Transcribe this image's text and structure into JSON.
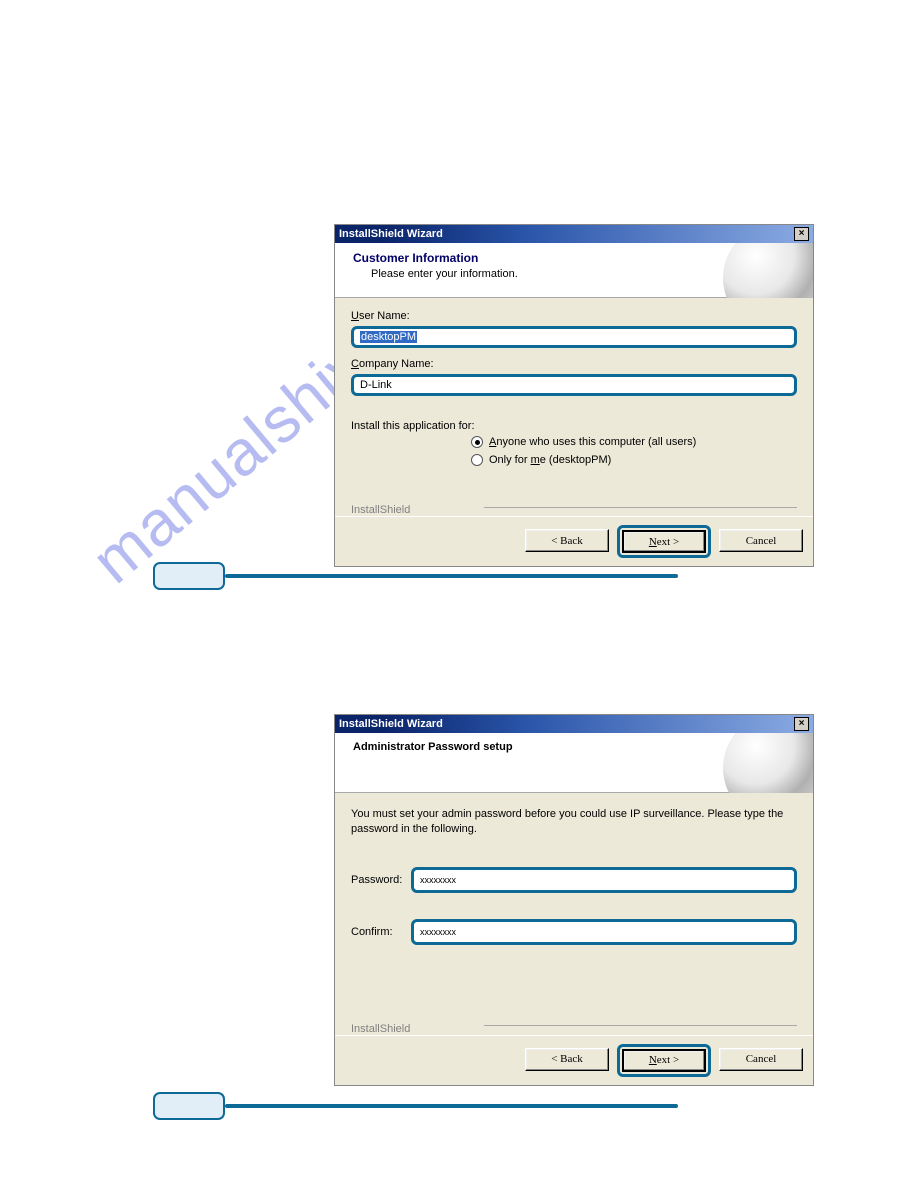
{
  "watermark_text": "manualshive.com",
  "dialog1": {
    "title": "InstallShield Wizard",
    "header_title": "Customer Information",
    "header_sub": "Please enter your information.",
    "user_label": "User Name:",
    "user_value": "desktopPM",
    "company_label": "Company Name:",
    "company_value": "D-Link",
    "install_for_label": "Install this application for:",
    "radio1": "Anyone who uses this computer (all users)",
    "radio2": "Only for me (desktopPM)",
    "brand": "InstallShield",
    "btn_back": "< Back",
    "btn_next": "Next >",
    "btn_cancel": "Cancel"
  },
  "dialog2": {
    "title": "InstallShield Wizard",
    "header_title": "Administrator Password setup",
    "instr": "You must set your admin password before you could use IP surveillance. Please type the password in the following.",
    "pw_label": "Password:",
    "pw_value": "xxxxxxxx",
    "confirm_label": "Confirm:",
    "confirm_value": "xxxxxxxx",
    "brand": "InstallShield",
    "btn_back": "< Back",
    "btn_next": "Next >",
    "btn_cancel": "Cancel"
  }
}
